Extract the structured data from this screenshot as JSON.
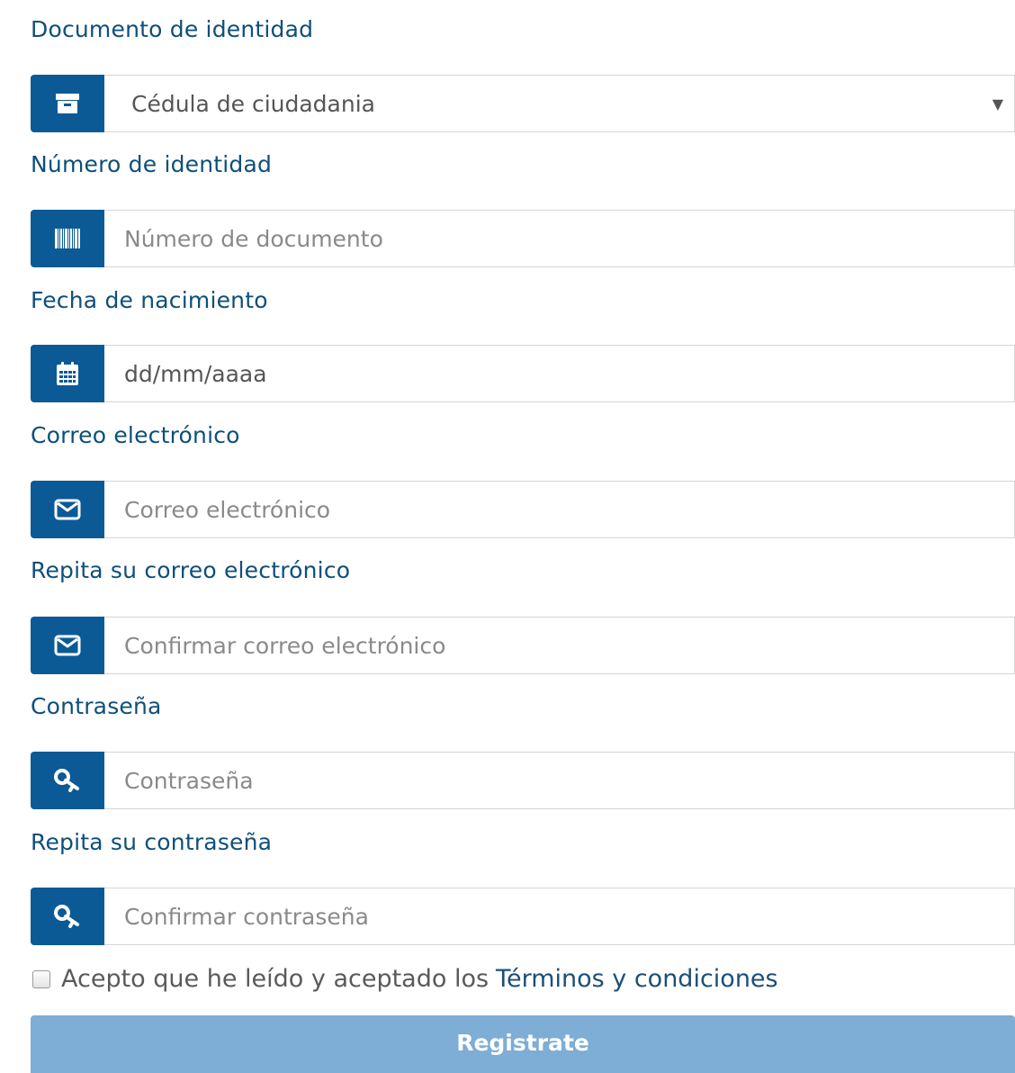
{
  "form": {
    "id_type": {
      "label": "Documento de identidad",
      "value": "Cédula de ciudadania",
      "icon": "archive-icon"
    },
    "id_number": {
      "label": "Número de identidad",
      "placeholder": "Número de documento",
      "icon": "barcode-icon"
    },
    "birth_date": {
      "label": "Fecha de nacimiento",
      "value": "dd/mm/aaaa",
      "icon": "calendar-icon"
    },
    "email": {
      "label": "Correo electrónico",
      "placeholder": "Correo electrónico",
      "icon": "envelope-icon"
    },
    "email_confirm": {
      "label": "Repita su correo electrónico",
      "placeholder": "Confirmar correo electrónico",
      "icon": "envelope-icon"
    },
    "password": {
      "label": "Contraseña",
      "placeholder": "Contraseña",
      "icon": "key-icon"
    },
    "password_confirm": {
      "label": "Repita su contraseña",
      "placeholder": "Confirmar contraseña",
      "icon": "key-icon"
    },
    "terms": {
      "text": "Acepto que he leído y aceptado los",
      "link": "Términos y condiciones",
      "checked": false
    },
    "submit_label": "Registrate"
  },
  "colors": {
    "label": "#0e4f7a",
    "addon": "#0b5a96",
    "button": "#7eadd6"
  }
}
